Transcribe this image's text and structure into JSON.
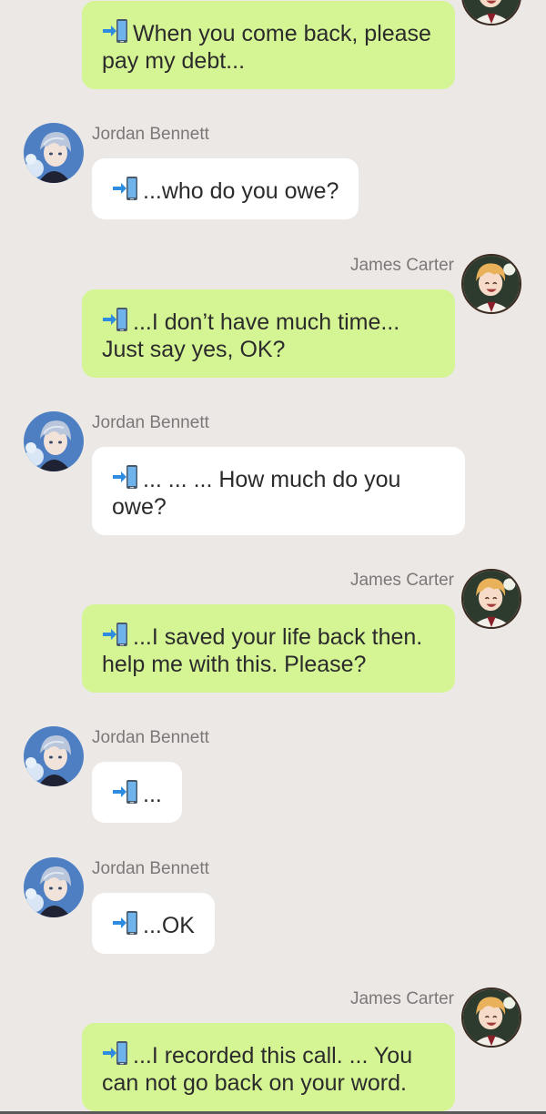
{
  "participants": {
    "jordan": {
      "name": "Jordan Bennett"
    },
    "james": {
      "name": "James Carter"
    }
  },
  "icons": {
    "call": "phone-call-icon"
  },
  "colors": {
    "background": "#ece8e6",
    "incoming_bubble": "#ffffff",
    "outgoing_bubble": "#d5f595",
    "name_text": "#7c7878"
  },
  "messages": [
    {
      "sender": "James Carter",
      "text": "When you come back, please pay my debt..."
    },
    {
      "sender": "Jordan Bennett",
      "text": "...who do you owe?"
    },
    {
      "sender": "James Carter",
      "text": "...I don’t have much time... Just say yes, OK?"
    },
    {
      "sender": "Jordan Bennett",
      "text": "... ... ... How much do you owe?"
    },
    {
      "sender": "James Carter",
      "text": "...I saved your life back then. help me with this. Please?"
    },
    {
      "sender": "Jordan Bennett",
      "text": "..."
    },
    {
      "sender": "Jordan Bennett",
      "text": "...OK"
    },
    {
      "sender": "James Carter",
      "text": "...I recorded this call. ... You can not go back on your word."
    }
  ]
}
